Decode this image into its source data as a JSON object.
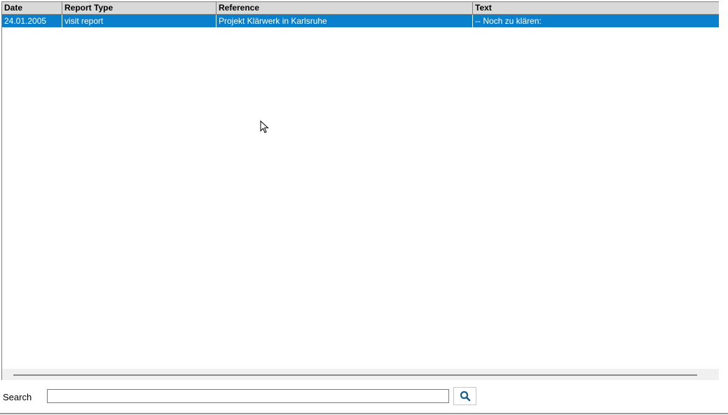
{
  "grid": {
    "columns": [
      {
        "key": "date",
        "label": "Date"
      },
      {
        "key": "report_type",
        "label": "Report Type"
      },
      {
        "key": "reference",
        "label": "Reference"
      },
      {
        "key": "text",
        "label": "Text"
      }
    ],
    "rows": [
      {
        "date": "24.01.2005",
        "report_type": "visit report",
        "reference": "Projekt Klärwerk in Karlsruhe",
        "text": "-- Noch zu klären:",
        "selected": true
      }
    ]
  },
  "search": {
    "label": "Search",
    "value": "",
    "placeholder": ""
  },
  "icons": {
    "search_button": "search-icon",
    "pointer": "mouse-pointer-icon"
  },
  "colors": {
    "selected_row": "#0a7fcb",
    "header_bg": "#d9d9d9",
    "icon": "#1c5f86"
  }
}
